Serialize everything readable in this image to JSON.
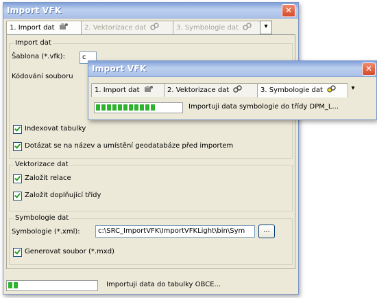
{
  "main_window": {
    "title": "Import VFK",
    "close": "✕",
    "tabs": [
      {
        "label": "1. Import dat",
        "icon": "import-icon"
      },
      {
        "label": "2. Vektorizace dat",
        "icon": "vectorize-icon"
      },
      {
        "label": "3. Symbologie dat",
        "icon": "symbology-icon"
      }
    ],
    "dropdown": "▾",
    "import_group": {
      "title": "Import dat",
      "template_label": "Šablona (*.vfk):",
      "template_value": "c",
      "encoding_label": "Kódování souboru",
      "index_tables": "Indexovat tabulky",
      "ask_gdb": "Dotázat se na název a umístění geodatabáze před importem"
    },
    "vector_group": {
      "title": "Vektorizace dat",
      "create_relations": "Založit relace",
      "create_classes": "Založit doplňující třídy"
    },
    "symbol_group": {
      "title": "Symbologie dat",
      "xml_label": "Symbologie (*.xml):",
      "xml_value": "c:\\SRC_ImportVFK\\ImportVFKLight\\bin\\Sym",
      "browse": "...",
      "generate_mxd": "Generovat soubor (*.mxd)"
    },
    "progress": 0.13,
    "status": "Importuji data do tabulky OBCE..."
  },
  "overlay_window": {
    "title": "Import VFK",
    "close": "✕",
    "tabs": [
      {
        "label": "1. Import dat",
        "icon": "import-icon"
      },
      {
        "label": "2. Vektorizace dat",
        "icon": "vectorize-icon"
      },
      {
        "label": "3. Symbologie dat",
        "icon": "symbology-icon"
      }
    ],
    "dropdown": "▾",
    "progress": 0.72,
    "status": "Importuji data symbologie do třídy DPM_L..."
  },
  "colors": {
    "progress_fill": "#2fb32f",
    "title_gradient": "#7f9fd8",
    "close_red": "#d54a2a"
  }
}
